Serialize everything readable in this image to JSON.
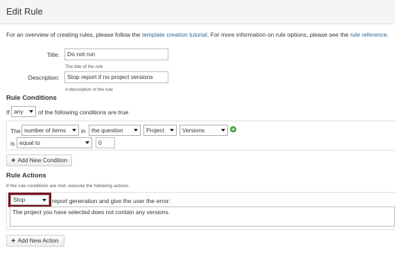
{
  "header": {
    "title": "Edit Rule"
  },
  "intro": {
    "prefix": "For an overview of creating rules, please follow the ",
    "link1": "template creation tutorial",
    "middle": ". For more information on rule options, please see the ",
    "link2": "rule reference",
    "suffix": "."
  },
  "title_field": {
    "label": "Title:",
    "value": "Do not run",
    "hint": "The title of the rule"
  },
  "description_field": {
    "label": "Description:",
    "value": "Stop report if no project versions",
    "hint": "A description of the rule"
  },
  "conditions": {
    "heading": "Rule Conditions",
    "if_label": "If",
    "quantifier": "any",
    "quantifier_suffix": "of the following conditions are true",
    "row": {
      "the_label": "The",
      "measure": "number of items",
      "in_label": "in",
      "source": "the question",
      "category": "Project",
      "field": "Versions",
      "is_label": "is",
      "operator": "equal to",
      "value": "0"
    },
    "add_button": "Add New Condition"
  },
  "actions": {
    "heading": "Rule Actions",
    "description": "If the rule conditions are met, execute the following actions.",
    "action": "Stop",
    "action_suffix": "report generation and give the user the error:",
    "message": "The project you have selected does not contain any versions.",
    "add_button": "Add New Action"
  },
  "colors": {
    "link": "#2a6496",
    "highlight": "#7a1019",
    "add_icon": "#3aa13a"
  }
}
